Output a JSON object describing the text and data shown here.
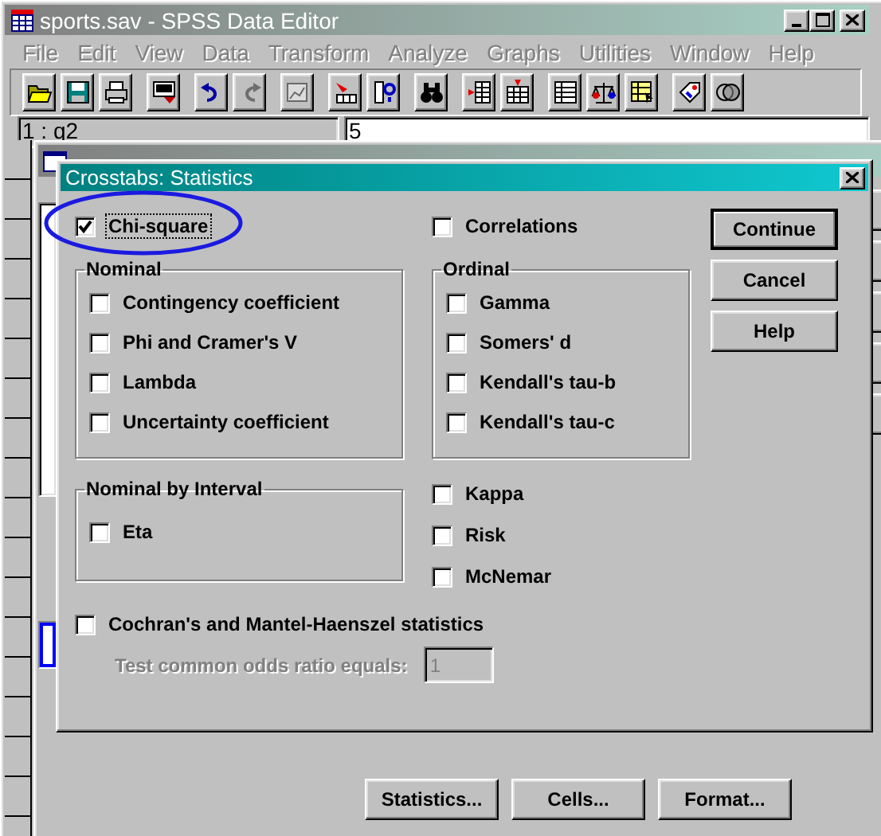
{
  "main_window": {
    "title": "sports.sav - SPSS Data Editor",
    "active": false
  },
  "menu": [
    {
      "label": "File",
      "disabled": true
    },
    {
      "label": "Edit",
      "disabled": true
    },
    {
      "label": "View",
      "disabled": true
    },
    {
      "label": "Data",
      "disabled": true
    },
    {
      "label": "Transform",
      "disabled": true
    },
    {
      "label": "Analyze",
      "disabled": true
    },
    {
      "label": "Graphs",
      "disabled": true
    },
    {
      "label": "Utilities",
      "disabled": true
    },
    {
      "label": "Window",
      "disabled": true
    },
    {
      "label": "Help",
      "disabled": true
    }
  ],
  "toolbar": [
    [
      {
        "kind": "open",
        "disabled": false
      },
      {
        "kind": "save",
        "disabled": false
      },
      {
        "kind": "print",
        "disabled": false
      }
    ],
    [
      {
        "kind": "recall",
        "disabled": false
      }
    ],
    [
      {
        "kind": "undo",
        "disabled": false
      },
      {
        "kind": "redo",
        "disabled": true
      }
    ],
    [
      {
        "kind": "chart",
        "disabled": true
      }
    ],
    [
      {
        "kind": "goto",
        "disabled": false
      },
      {
        "kind": "variables",
        "disabled": false
      }
    ],
    [
      {
        "kind": "find",
        "disabled": false
      }
    ],
    [
      {
        "kind": "insert_case",
        "disabled": false
      },
      {
        "kind": "insert_variable",
        "disabled": false
      }
    ],
    [
      {
        "kind": "split",
        "disabled": false
      },
      {
        "kind": "weight",
        "disabled": false
      },
      {
        "kind": "select",
        "disabled": false
      }
    ],
    [
      {
        "kind": "labels",
        "disabled": false
      },
      {
        "kind": "sets",
        "disabled": false
      }
    ]
  ],
  "cell_bar": {
    "cell": "1 : q2",
    "value": "5"
  },
  "crosstabs_dialog": {
    "active": false,
    "buttons": [
      "Statistics...",
      "Cells...",
      "Format..."
    ]
  },
  "statistics_dialog": {
    "title": "Crosstabs: Statistics",
    "active": true,
    "chi_square": {
      "label": "Chi-square",
      "checked": true,
      "focused": true
    },
    "correlations": {
      "label": "Correlations",
      "checked": false
    },
    "groups": [
      {
        "title": "Nominal",
        "items": [
          {
            "label": "Contingency coefficient",
            "checked": false
          },
          {
            "label": "Phi and Cramer's V",
            "checked": false
          },
          {
            "label": "Lambda",
            "checked": false
          },
          {
            "label": "Uncertainty coefficient",
            "checked": false
          }
        ]
      },
      {
        "title": "Ordinal",
        "items": [
          {
            "label": "Gamma",
            "checked": false
          },
          {
            "label": "Somers' d",
            "checked": false
          },
          {
            "label": "Kendall's tau-b",
            "checked": false
          },
          {
            "label": "Kendall's tau-c",
            "checked": false
          }
        ]
      },
      {
        "title": "Nominal by Interval",
        "items": [
          {
            "label": "Eta",
            "checked": false
          }
        ]
      }
    ],
    "other": [
      {
        "label": "Kappa",
        "checked": false
      },
      {
        "label": "Risk",
        "checked": false
      },
      {
        "label": "McNemar",
        "checked": false
      }
    ],
    "cochran": {
      "label": "Cochran's and Mantel-Haenszel statistics",
      "checked": false
    },
    "odds_ratio": {
      "label": "Test common odds ratio equals:",
      "value": "1",
      "disabled": true
    },
    "buttons": [
      {
        "label": "Continue",
        "default": true
      },
      {
        "label": "Cancel",
        "default": false
      },
      {
        "label": "Help",
        "default": false
      }
    ]
  },
  "highlight": {
    "kind": "ellipse"
  }
}
